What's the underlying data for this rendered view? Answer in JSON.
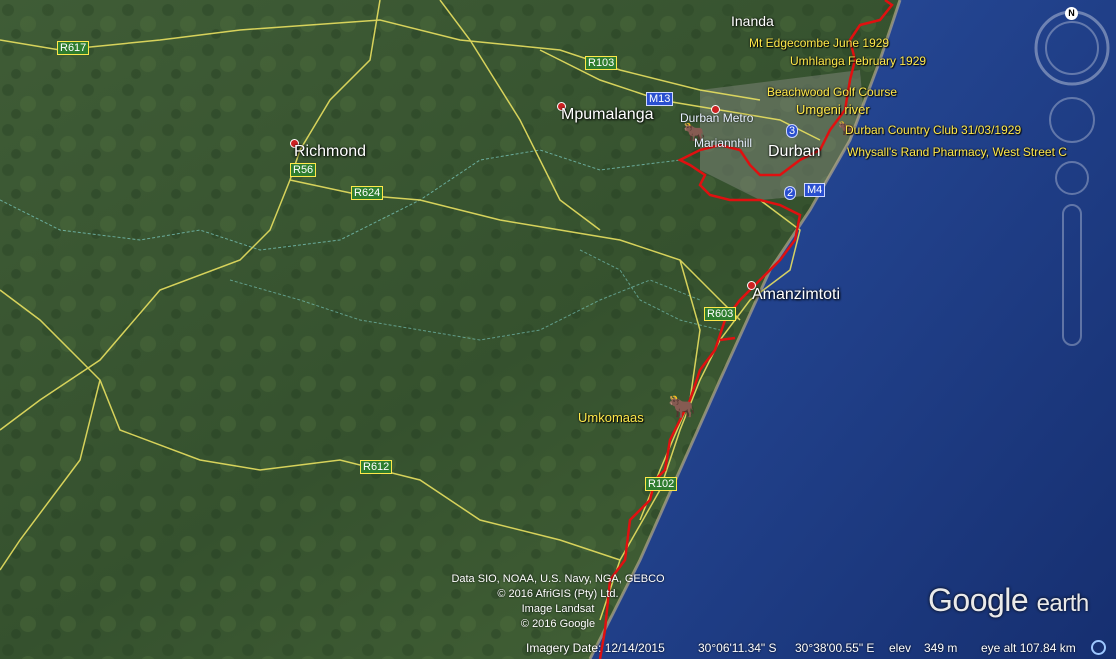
{
  "towns": {
    "inanda": "Inanda",
    "mpumalanga": "Mpumalanga",
    "richmond": "Richmond",
    "durban": "Durban",
    "durban_metro": "Durban Metro",
    "mariannhill": "Mariannhill",
    "amanzimtoti": "Amanzimtoti",
    "umkomaas": "Umkomaas",
    "umgeni_river": "Umgeni river"
  },
  "placemarks": {
    "mt_edgecombe": "Mt Edgecombe June 1929",
    "umhlanga": "Umhlanga February 1929",
    "beachwood": "Beachwood Golf Course",
    "durban_country_club": "Durban Country Club 31/03/1929",
    "whysalls": "Whysall's Rand Pharmacy, West Street C"
  },
  "roads": {
    "r617": "R617",
    "r103": "R103",
    "m13": "M13",
    "r56": "R56",
    "r624": "R624",
    "r603": "R603",
    "r612": "R612",
    "r102": "R102",
    "m4": "M4",
    "n3": "3",
    "n2": "2"
  },
  "credits": {
    "line1": "Data SIO, NOAA, U.S. Navy, NGA, GEBCO",
    "line2": "© 2016 AfriGIS (Pty) Ltd.",
    "line3": "Image Landsat",
    "line4": "© 2016 Google"
  },
  "status": {
    "imagery_date": "Imagery Date: 12/14/2015",
    "latitude": "30°06'11.34\" S",
    "longitude": "30°38'00.55\" E",
    "elev_label": "elev",
    "elev_value": "349 m",
    "eye_alt": "eye alt 107.84 km"
  },
  "logo": {
    "google": "Google",
    "earth": "earth"
  },
  "compass": {
    "north": "N"
  },
  "colors": {
    "land": "#3d5a34",
    "ocean": "#1e3a80",
    "route": "#e01010",
    "roads": "#e8e060",
    "borders": "#7fd0c8"
  }
}
